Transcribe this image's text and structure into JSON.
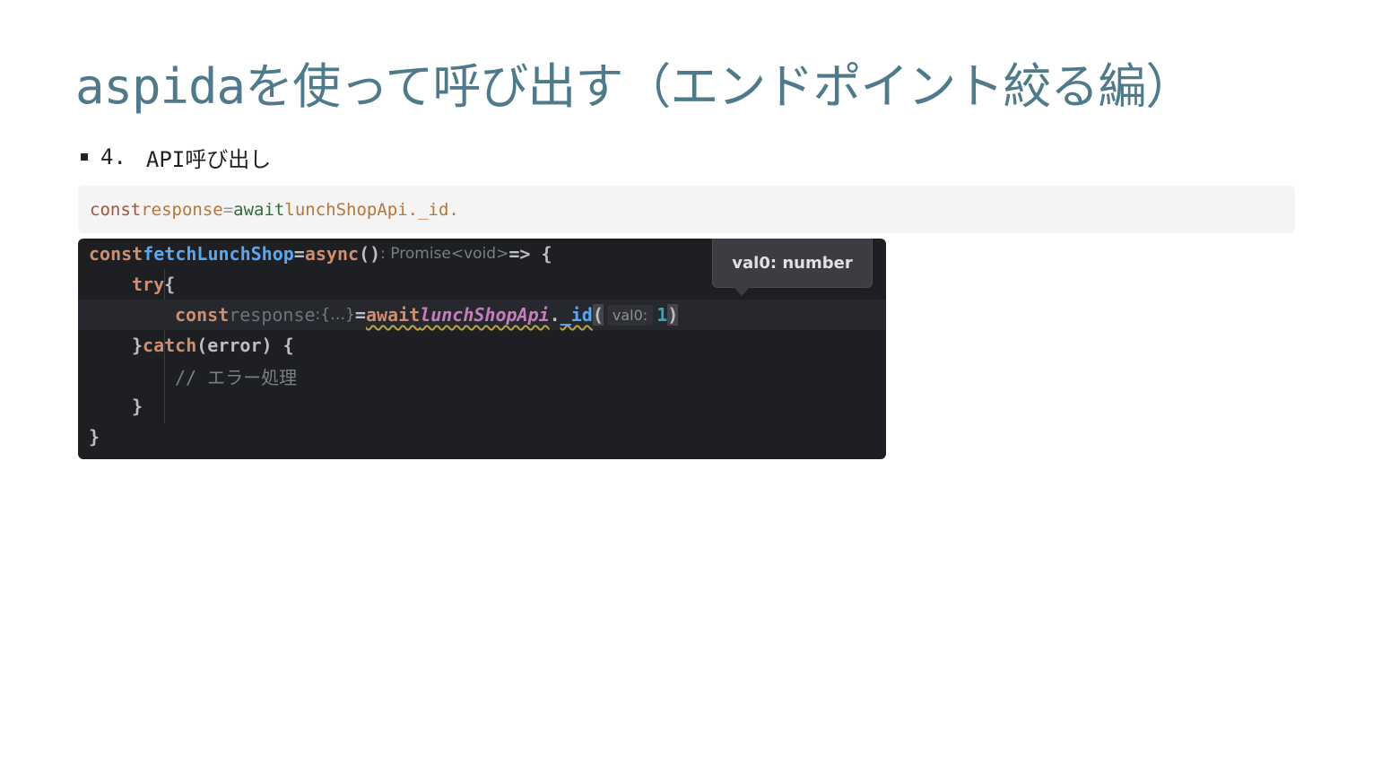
{
  "title": "aspidaを使って呼び出す（エンドポイント絞る編）",
  "bullets": [
    {
      "number": "4.",
      "text": "API呼び出し"
    }
  ],
  "inline_code": {
    "kw_const": "const",
    "var": "response",
    "op": "=",
    "await": "await",
    "expr": "lunchShopApi._id."
  },
  "editor": {
    "line1": {
      "const": "const",
      "fn": "fetchLunchShop",
      "eq": "=",
      "async": "async",
      "parens": "()",
      "hint": ": Promise<void>",
      "arrow": "=> {"
    },
    "line2": {
      "try": "try",
      "brace": "{"
    },
    "line3": {
      "const": "const",
      "var": "response",
      "hint": ":{…}",
      "eq": "=",
      "await": "await",
      "obj": "lunchShopApi",
      "dot": ".",
      "method": "_id",
      "open_paren": "(",
      "param_hint": "val0:",
      "arg": "1",
      "close_paren": ")"
    },
    "line4": {
      "close": "}",
      "catch": "catch",
      "args": "(error) {"
    },
    "line5": {
      "comment": "// エラー処理"
    },
    "line6": {
      "close": "}"
    },
    "line7": {
      "close": "}"
    }
  },
  "tooltip": {
    "text": "val0: number"
  },
  "colors": {
    "title": "#4f7a8a",
    "editor_bg": "#1e1f22",
    "keyword": "#cf8e6d",
    "function": "#56a8f5",
    "number": "#2aacb8"
  }
}
